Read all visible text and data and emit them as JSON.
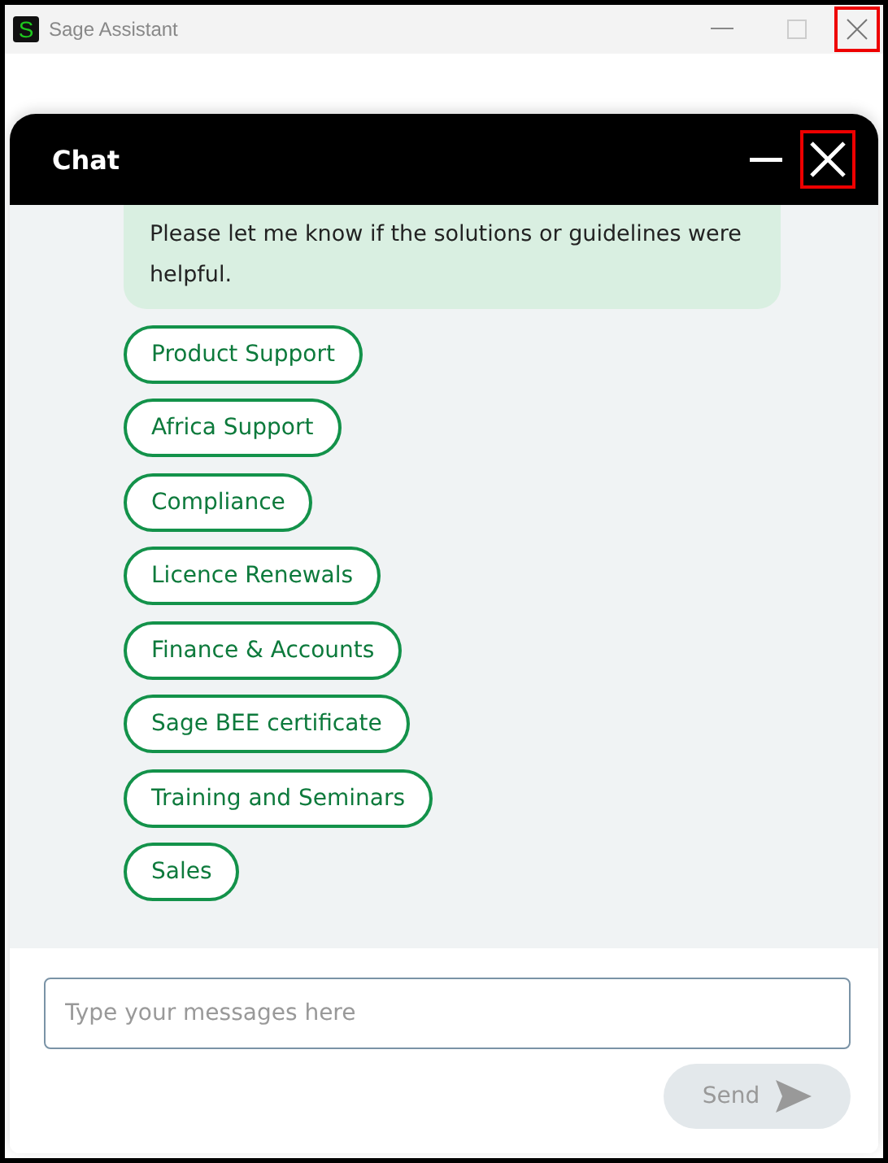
{
  "window": {
    "title": "Sage Assistant",
    "app_icon": "S"
  },
  "chat": {
    "title": "Chat",
    "message": "Please let me know if the solutions or guidelines were helpful.",
    "options": [
      "Product Support",
      "Africa Support",
      "Compliance",
      "Licence Renewals",
      "Finance & Accounts",
      "Sage BEE certificate",
      "Training and Seminars",
      "Sales"
    ],
    "input": {
      "placeholder": "Type your messages here"
    },
    "send": {
      "label": "Send",
      "disabled": true
    }
  }
}
